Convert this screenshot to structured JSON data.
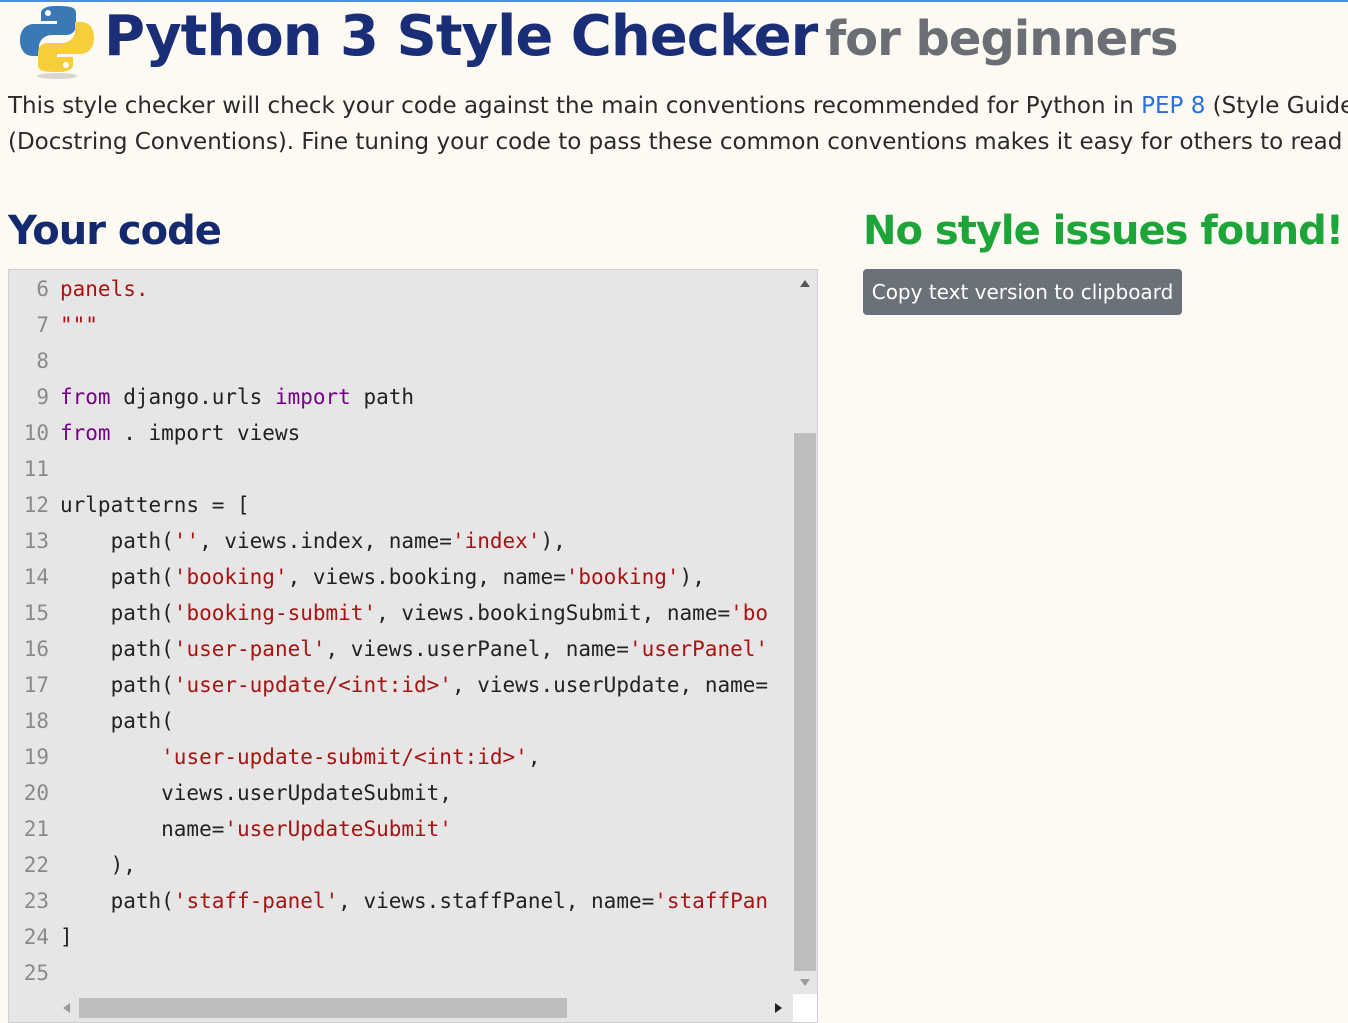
{
  "header": {
    "logo_icon": "python-logo-icon",
    "title_main": "Python 3 Style Checker",
    "title_sub": "for beginners"
  },
  "intro": {
    "line1_before": "This style checker will check your code against the main conventions recommended for Python in ",
    "line1_link": "PEP 8",
    "line1_after": " (Style Guide for",
    "line2": "(Docstring Conventions). Fine tuning your code to pass these common conventions makes it easy for others to read you"
  },
  "code_heading": "Your code",
  "result": {
    "heading": "No style issues found!",
    "copy_button": "Copy text version to clipboard"
  },
  "colors": {
    "title": "#1a2e78",
    "subtitle": "#6b6f75",
    "success": "#1ea53a",
    "link": "#2a6fdb",
    "keyword": "#770088",
    "string": "#aa1111",
    "button": "#6a7178"
  },
  "editor": {
    "lines": [
      {
        "n": "6",
        "tokens": [
          {
            "t": "panels.",
            "c": "str"
          }
        ]
      },
      {
        "n": "7",
        "tokens": [
          {
            "t": "\"\"\"",
            "c": "str"
          }
        ]
      },
      {
        "n": "8",
        "tokens": []
      },
      {
        "n": "9",
        "tokens": [
          {
            "t": "from",
            "c": "kw"
          },
          {
            "t": " django.urls ",
            "c": "plain"
          },
          {
            "t": "import",
            "c": "kw"
          },
          {
            "t": " path",
            "c": "plain"
          }
        ]
      },
      {
        "n": "10",
        "tokens": [
          {
            "t": "from",
            "c": "kw"
          },
          {
            "t": " . import views",
            "c": "plain"
          }
        ]
      },
      {
        "n": "11",
        "tokens": []
      },
      {
        "n": "12",
        "tokens": [
          {
            "t": "urlpatterns = [",
            "c": "plain"
          }
        ]
      },
      {
        "n": "13",
        "tokens": [
          {
            "t": "    path(",
            "c": "plain"
          },
          {
            "t": "''",
            "c": "str"
          },
          {
            "t": ", views.index, name=",
            "c": "plain"
          },
          {
            "t": "'index'",
            "c": "str"
          },
          {
            "t": "),",
            "c": "plain"
          }
        ]
      },
      {
        "n": "14",
        "tokens": [
          {
            "t": "    path(",
            "c": "plain"
          },
          {
            "t": "'booking'",
            "c": "str"
          },
          {
            "t": ", views.booking, name=",
            "c": "plain"
          },
          {
            "t": "'booking'",
            "c": "str"
          },
          {
            "t": "),",
            "c": "plain"
          }
        ]
      },
      {
        "n": "15",
        "tokens": [
          {
            "t": "    path(",
            "c": "plain"
          },
          {
            "t": "'booking-submit'",
            "c": "str"
          },
          {
            "t": ", views.bookingSubmit, name=",
            "c": "plain"
          },
          {
            "t": "'bo",
            "c": "str"
          }
        ]
      },
      {
        "n": "16",
        "tokens": [
          {
            "t": "    path(",
            "c": "plain"
          },
          {
            "t": "'user-panel'",
            "c": "str"
          },
          {
            "t": ", views.userPanel, name=",
            "c": "plain"
          },
          {
            "t": "'userPanel'",
            "c": "str"
          }
        ]
      },
      {
        "n": "17",
        "tokens": [
          {
            "t": "    path(",
            "c": "plain"
          },
          {
            "t": "'user-update/<int:id>'",
            "c": "str"
          },
          {
            "t": ", views.userUpdate, name=",
            "c": "plain"
          }
        ]
      },
      {
        "n": "18",
        "tokens": [
          {
            "t": "    path(",
            "c": "plain"
          }
        ]
      },
      {
        "n": "19",
        "tokens": [
          {
            "t": "        ",
            "c": "plain"
          },
          {
            "t": "'user-update-submit/<int:id>'",
            "c": "str"
          },
          {
            "t": ",",
            "c": "plain"
          }
        ]
      },
      {
        "n": "20",
        "tokens": [
          {
            "t": "        views.userUpdateSubmit,",
            "c": "plain"
          }
        ]
      },
      {
        "n": "21",
        "tokens": [
          {
            "t": "        name=",
            "c": "plain"
          },
          {
            "t": "'userUpdateSubmit'",
            "c": "str"
          }
        ]
      },
      {
        "n": "22",
        "tokens": [
          {
            "t": "    ),",
            "c": "plain"
          }
        ]
      },
      {
        "n": "23",
        "tokens": [
          {
            "t": "    path(",
            "c": "plain"
          },
          {
            "t": "'staff-panel'",
            "c": "str"
          },
          {
            "t": ", views.staffPanel, name=",
            "c": "plain"
          },
          {
            "t": "'staffPan",
            "c": "str"
          }
        ]
      },
      {
        "n": "24",
        "tokens": [
          {
            "t": "]",
            "c": "plain"
          }
        ]
      },
      {
        "n": "25",
        "tokens": []
      }
    ]
  }
}
